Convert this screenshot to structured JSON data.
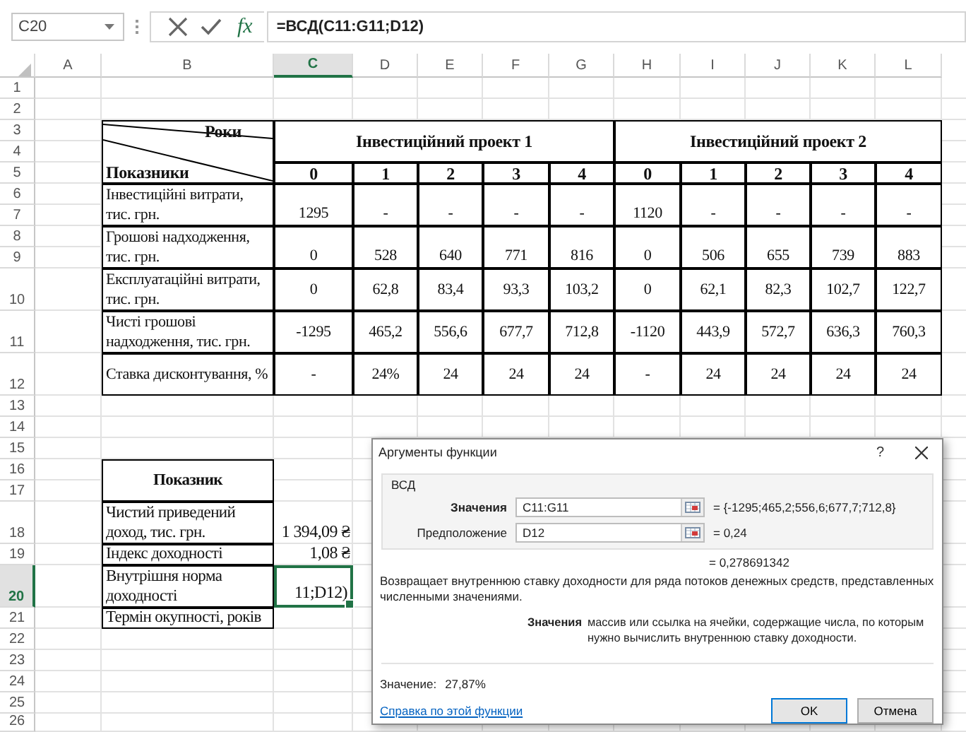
{
  "formula_bar": {
    "name_box": "C20",
    "function_button": "fx",
    "formula": "=ВСД(C11:G11;D12)"
  },
  "columns": [
    {
      "label": "A",
      "selected": false
    },
    {
      "label": "B",
      "selected": false
    },
    {
      "label": "C",
      "selected": true
    },
    {
      "label": "D",
      "selected": false
    },
    {
      "label": "E",
      "selected": false
    },
    {
      "label": "F",
      "selected": false
    },
    {
      "label": "G",
      "selected": false
    },
    {
      "label": "H",
      "selected": false
    },
    {
      "label": "I",
      "selected": false
    },
    {
      "label": "J",
      "selected": false
    },
    {
      "label": "K",
      "selected": false
    },
    {
      "label": "L",
      "selected": false
    }
  ],
  "rows": [
    {
      "label": "1",
      "selected": false
    },
    {
      "label": "2",
      "selected": false
    },
    {
      "label": "3",
      "selected": false
    },
    {
      "label": "4",
      "selected": false
    },
    {
      "label": "5",
      "selected": false
    },
    {
      "label": "6",
      "selected": false
    },
    {
      "label": "7",
      "selected": false
    },
    {
      "label": "8",
      "selected": false
    },
    {
      "label": "9",
      "selected": false
    },
    {
      "label": "10",
      "selected": false
    },
    {
      "label": "11",
      "selected": false
    },
    {
      "label": "12",
      "selected": false
    },
    {
      "label": "13",
      "selected": false
    },
    {
      "label": "14",
      "selected": false
    },
    {
      "label": "15",
      "selected": false
    },
    {
      "label": "16",
      "selected": false
    },
    {
      "label": "17",
      "selected": false
    },
    {
      "label": "18",
      "selected": false
    },
    {
      "label": "19",
      "selected": false
    },
    {
      "label": "20",
      "selected": true
    },
    {
      "label": "21",
      "selected": false
    },
    {
      "label": "22",
      "selected": false
    },
    {
      "label": "23",
      "selected": false
    },
    {
      "label": "24",
      "selected": false
    },
    {
      "label": "25",
      "selected": false
    },
    {
      "label": "26",
      "selected": false
    }
  ],
  "investment_table": {
    "header_years": "Роки",
    "header_indicators": "Показники",
    "projects": [
      "Інвестиційний проект 1",
      "Інвестиційний проект 2"
    ],
    "periods": [
      "0",
      "1",
      "2",
      "3",
      "4",
      "0",
      "1",
      "2",
      "3",
      "4"
    ],
    "rows": [
      {
        "label_lines": [
          "Інвестиційні витрати,",
          "тис. грн."
        ],
        "values": [
          "1295",
          "-",
          "-",
          "-",
          "-",
          "1120",
          "-",
          "-",
          "-",
          "-"
        ]
      },
      {
        "label_lines": [
          "Грошові надходження,",
          "тис. грн."
        ],
        "values": [
          "0",
          "528",
          "640",
          "771",
          "816",
          "0",
          "506",
          "655",
          "739",
          "883"
        ]
      },
      {
        "label_lines": [
          "Експлуатаційні витрати,",
          "тис. грн."
        ],
        "values": [
          "0",
          "62,8",
          "83,4",
          "93,3",
          "103,2",
          "0",
          "62,1",
          "82,3",
          "102,7",
          "122,7"
        ]
      },
      {
        "label_lines": [
          "Чисті грошові",
          "надходження, тис. грн."
        ],
        "values": [
          "-1295",
          "465,2",
          "556,6",
          "677,7",
          "712,8",
          "-1120",
          "443,9",
          "572,7",
          "636,3",
          "760,3"
        ]
      },
      {
        "label_lines": [
          "Ставка дисконтування, %"
        ],
        "values": [
          "-",
          "24%",
          "24",
          "24",
          "24",
          "-",
          "24",
          "24",
          "24",
          "24"
        ]
      }
    ]
  },
  "summary_table": {
    "header": "Показник",
    "rows": [
      {
        "label_lines": [
          "Чистий приведений",
          "доход, тис. грн."
        ],
        "value": "1 394,09 ₴",
        "selected": false
      },
      {
        "label_lines": [
          "Індекс доходності"
        ],
        "value": "1,08 ₴",
        "selected": false
      },
      {
        "label_lines": [
          "Внутрішня норма",
          "доходності"
        ],
        "value": "11;D12)",
        "selected": true
      },
      {
        "label_lines": [
          "Термін окупності, років"
        ],
        "selected": false
      }
    ]
  },
  "dialog": {
    "title": "Аргументы функции",
    "help_button": "?",
    "function_name": "ВСД",
    "arguments": [
      {
        "label": "Значения",
        "bold": true,
        "value": "C11:G11",
        "result": "= {-1295;465,2;556,6;677,7;712,8}"
      },
      {
        "label": "Предположение",
        "bold": false,
        "value": "D12",
        "result": "= 0,24"
      }
    ],
    "overall_result": "= 0,278691342",
    "description": "Возвращает внутреннюю ставку доходности для ряда потоков денежных средств, представленных численными значениями.",
    "argument_help_name": "Значения",
    "argument_help_text": "массив или ссылка на ячейки, содержащие числа, по которым нужно вычислить внутреннюю ставку доходности.",
    "value_label": "Значение:",
    "value": "27,87%",
    "help_link": "Справка по этой функции",
    "buttons": [
      "OK",
      "Отмена"
    ]
  }
}
